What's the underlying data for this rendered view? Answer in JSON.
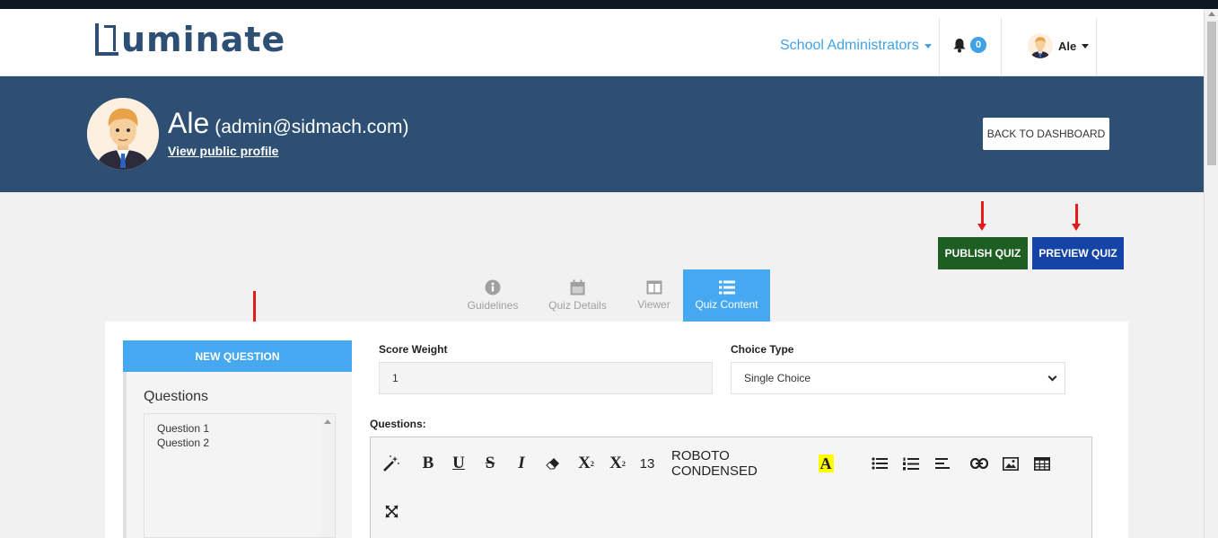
{
  "brand": {
    "name": "uminate"
  },
  "nav": {
    "role_menu": "School Administrators",
    "notifications_count": "0",
    "user_name": "Ale"
  },
  "profile": {
    "name": "Ale",
    "email": "(admin@sidmach.com)",
    "link": "View public profile",
    "back_button": "BACK TO DASHBOARD"
  },
  "actions": {
    "publish": "PUBLISH QUIZ",
    "preview": "PREVIEW QUIZ"
  },
  "tabs": [
    {
      "label": "Guidelines",
      "icon": "info-circle-icon",
      "active": false
    },
    {
      "label": "Quiz Details",
      "icon": "calendar-icon",
      "active": false
    },
    {
      "label": "Viewer",
      "icon": "columns-icon",
      "active": false
    },
    {
      "label": "Quiz Content",
      "icon": "list-icon",
      "active": true
    }
  ],
  "sidebar": {
    "new_question": "NEW QUESTION",
    "title": "Questions",
    "items": [
      "Question 1",
      "Question 2"
    ]
  },
  "form": {
    "score_weight_label": "Score Weight",
    "score_weight_value": "1",
    "choice_type_label": "Choice Type",
    "choice_type_value": "Single Choice",
    "questions_label": "Questions:"
  },
  "editor": {
    "font_size": "13",
    "font_name": "ROBOTO CONDENSED",
    "tools": [
      "magic-wand-icon",
      "bold-icon",
      "underline-icon",
      "strikethrough-icon",
      "italic-icon",
      "eraser-icon",
      "superscript-icon",
      "subscript-icon",
      "highlight-color-icon",
      "unordered-list-icon",
      "ordered-list-icon",
      "align-icon",
      "link-icon",
      "image-icon",
      "table-icon",
      "fullscreen-icon"
    ]
  },
  "colors": {
    "navy": "#2c4f73",
    "accent_blue": "#45a8f0",
    "publish_green": "#1e5e22",
    "preview_blue": "#1544a6",
    "annotation_red": "#e31b1b"
  }
}
